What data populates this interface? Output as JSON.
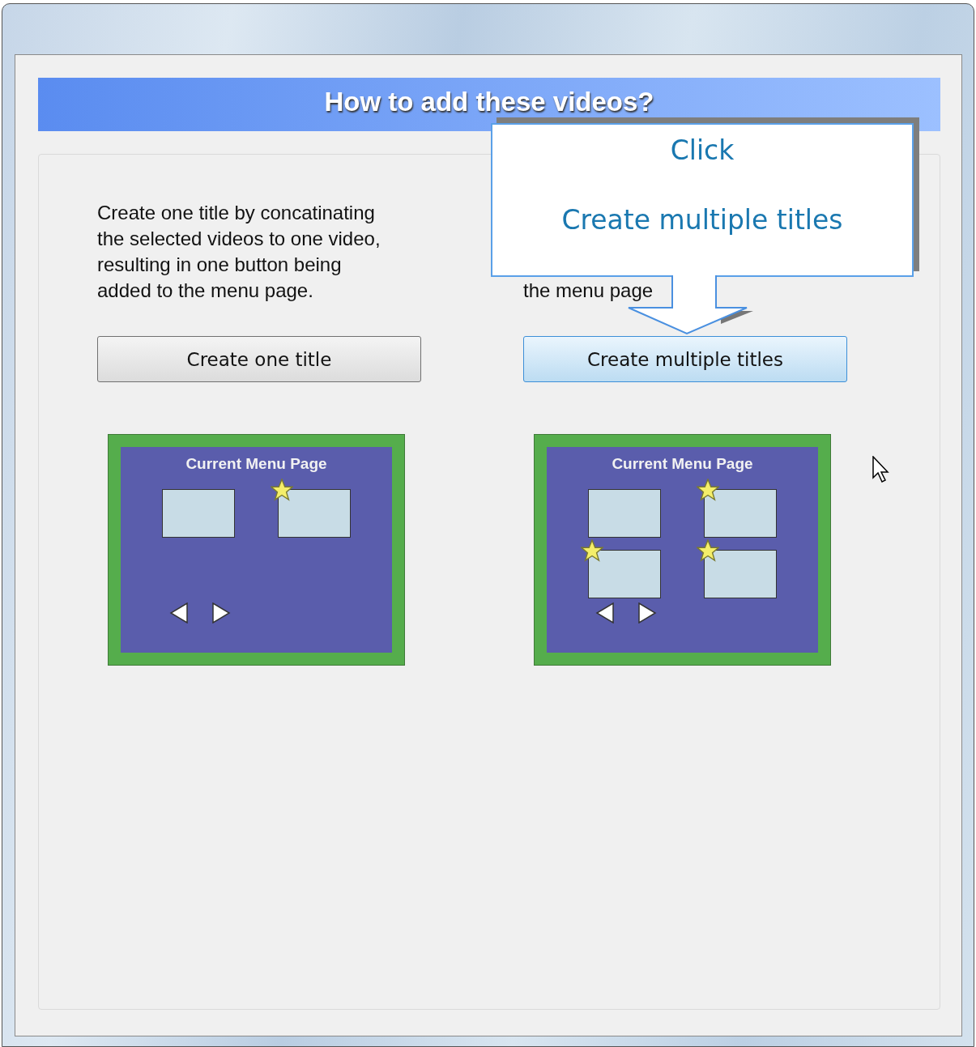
{
  "window": {
    "header": "How to add these videos?"
  },
  "options": [
    {
      "description": "Create one title by concatinating the selected videos to one video, resulting in one button being added to the menu page.",
      "button": {
        "label": "Create one title",
        "highlighted": false
      },
      "preview": {
        "title": "Current Menu Page",
        "tiles": [
          {
            "starred": false
          },
          {
            "starred": true
          }
        ]
      }
    },
    {
      "description": "the menu page",
      "button": {
        "label": "Create multiple titles",
        "highlighted": true
      },
      "preview": {
        "title": "Current Menu Page",
        "tiles": [
          {
            "starred": false
          },
          {
            "starred": true
          },
          {
            "starred": true
          },
          {
            "starred": true
          }
        ]
      }
    }
  ],
  "callout": {
    "lines": [
      "Click",
      "Create multiple titles"
    ]
  }
}
